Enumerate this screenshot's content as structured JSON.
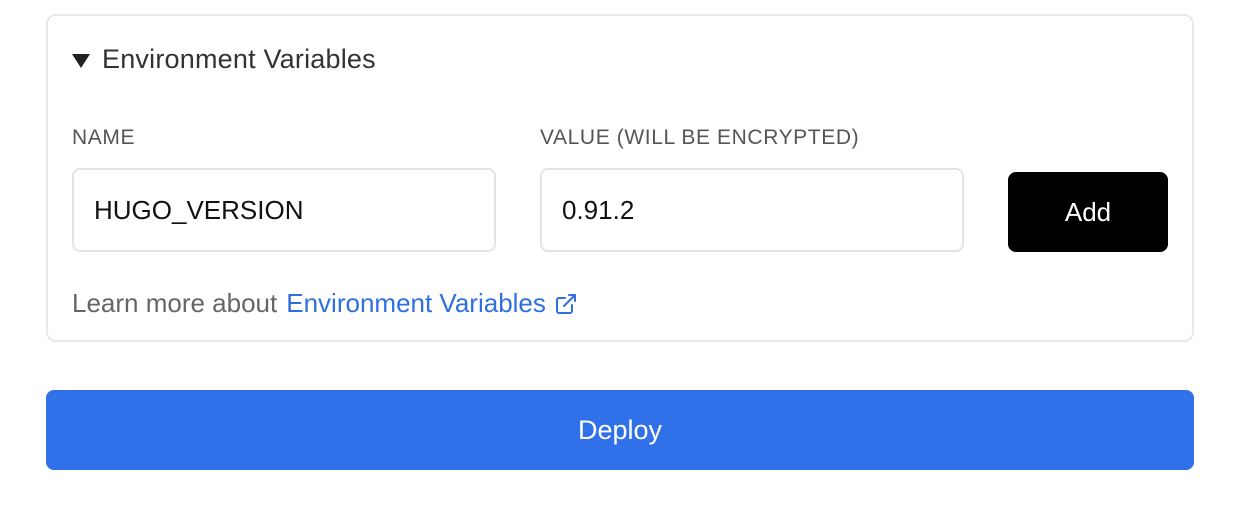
{
  "env_section": {
    "title": "Environment Variables",
    "expanded": true,
    "name_label": "NAME",
    "value_label": "VALUE (WILL BE ENCRYPTED)",
    "name_value": "HUGO_VERSION",
    "value_value": "0.91.2",
    "add_label": "Add",
    "learn_prefix": "Learn more about",
    "learn_link": "Environment Variables",
    "learn_icon": "external-link-icon"
  },
  "deploy": {
    "label": "Deploy"
  },
  "colors": {
    "link": "#2f6fe0",
    "deploy_bg": "#3070e8",
    "add_bg": "#000000",
    "border": "#e8e8e8"
  }
}
